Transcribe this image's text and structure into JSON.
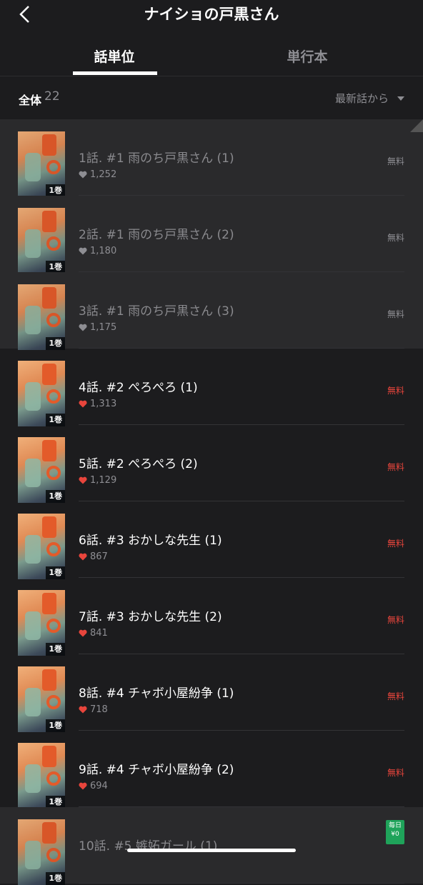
{
  "header": {
    "title": "ナイショの戸黒さん"
  },
  "tabs": [
    {
      "label": "話単位",
      "active": true
    },
    {
      "label": "単行本",
      "active": false
    }
  ],
  "filter": {
    "total_label": "全体",
    "total_count": "22",
    "sort_label": "最新話から"
  },
  "colors": {
    "accent_red": "#e8453c",
    "badge_green": "#1fa35a"
  },
  "episodes": [
    {
      "title": "1話. #1 雨のち戸黒さん (1)",
      "likes": "1,252",
      "price": "無料",
      "volume": "1巻",
      "read": true
    },
    {
      "title": "2話. #1 雨のち戸黒さん (2)",
      "likes": "1,180",
      "price": "無料",
      "volume": "1巻",
      "read": true
    },
    {
      "title": "3話. #1 雨のち戸黒さん (3)",
      "likes": "1,175",
      "price": "無料",
      "volume": "1巻",
      "read": true
    },
    {
      "title": "4話. #2 ぺろぺろ (1)",
      "likes": "1,313",
      "price": "無料",
      "volume": "1巻",
      "read": false
    },
    {
      "title": "5話. #2 ぺろぺろ (2)",
      "likes": "1,129",
      "price": "無料",
      "volume": "1巻",
      "read": false
    },
    {
      "title": "6話. #3 おかしな先生 (1)",
      "likes": "867",
      "price": "無料",
      "volume": "1巻",
      "read": false
    },
    {
      "title": "7話. #3 おかしな先生 (2)",
      "likes": "841",
      "price": "無料",
      "volume": "1巻",
      "read": false
    },
    {
      "title": "8話. #4 チャボ小屋紛争 (1)",
      "likes": "718",
      "price": "無料",
      "volume": "1巻",
      "read": false
    },
    {
      "title": "9話. #4 チャボ小屋紛争 (2)",
      "likes": "694",
      "price": "無料",
      "volume": "1巻",
      "read": false
    },
    {
      "title": "10話. #5 嫉妬ガール (1)",
      "likes": "",
      "price": "",
      "badge": "毎日 ¥0",
      "volume": "1巻",
      "read": true
    }
  ]
}
